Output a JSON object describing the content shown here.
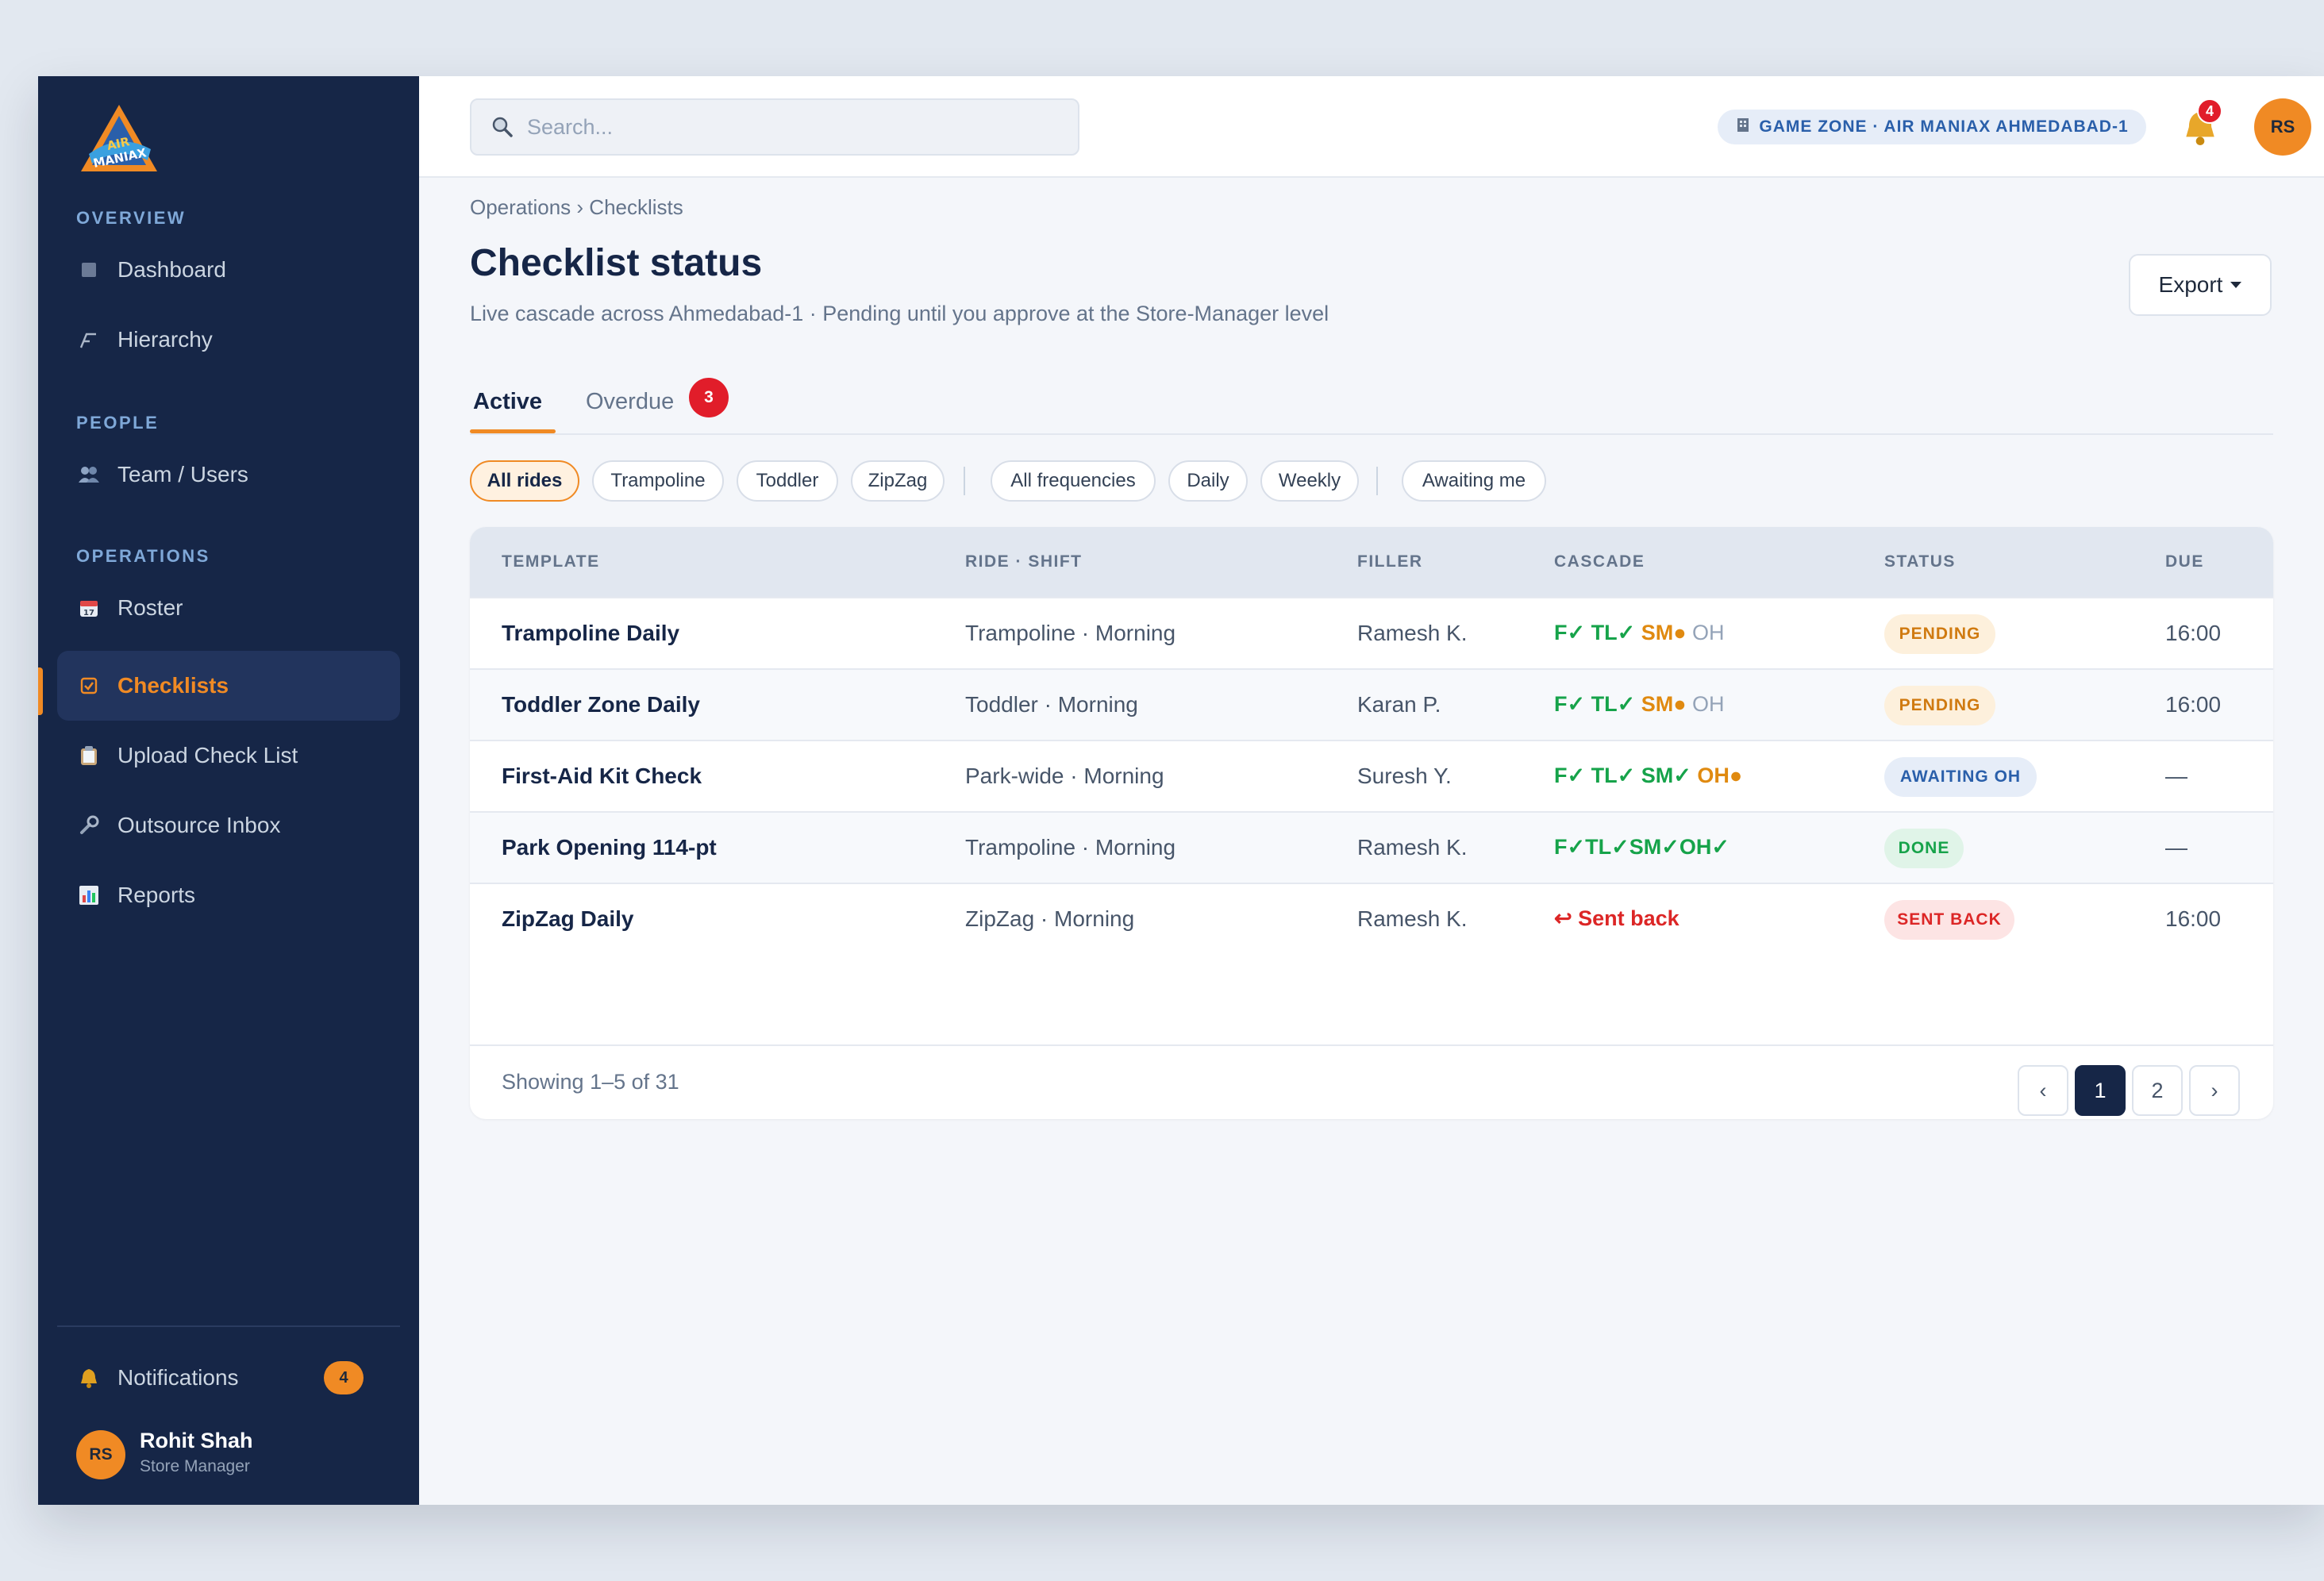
{
  "brand": {
    "logo_text": "AIR MANIAX"
  },
  "sidebar": {
    "sections": {
      "overview": "OVERVIEW",
      "people": "PEOPLE",
      "operations": "OPERATIONS"
    },
    "items": {
      "dashboard": "Dashboard",
      "hierarchy": "Hierarchy",
      "team": "Team / Users",
      "roster": "Roster",
      "checklists": "Checklists",
      "upload": "Upload Check List",
      "outsource": "Outsource Inbox",
      "reports": "Reports"
    },
    "notifications": {
      "label": "Notifications",
      "count": "4"
    },
    "user": {
      "initials": "RS",
      "name": "Rohit Shah",
      "role": "Store Manager"
    }
  },
  "topbar": {
    "search_placeholder": "Search...",
    "zone": "GAME ZONE · AIR MANIAX AHMEDABAD-1",
    "bell_count": "4",
    "avatar": "RS"
  },
  "page": {
    "breadcrumb": "Operations › Checklists",
    "title": "Checklist status",
    "subtitle": "Live cascade across Ahmedabad-1 · Pending until you approve at the Store-Manager level",
    "export": "Export"
  },
  "tabs": {
    "active": "Active",
    "overdue": "Overdue",
    "overdue_count": "3"
  },
  "filters": {
    "rides": [
      "All rides",
      "Trampoline",
      "Toddler",
      "ZipZag"
    ],
    "frequencies": [
      "All frequencies",
      "Daily",
      "Weekly"
    ],
    "awaiting": "Awaiting me",
    "selected": "All rides"
  },
  "table": {
    "headers": {
      "template": "TEMPLATE",
      "ride": "RIDE · SHIFT",
      "filler": "FILLER",
      "cascade": "CASCADE",
      "status": "STATUS",
      "due": "DUE"
    },
    "rows": [
      {
        "template": "Trampoline Daily",
        "ride": "Trampoline · Morning",
        "filler": "Ramesh K.",
        "cascade": {
          "done": "F✓ TL✓ ",
          "pending": "SM●",
          "todo": " OH"
        },
        "status": "PENDING",
        "due": "16:00"
      },
      {
        "template": "Toddler Zone Daily",
        "ride": "Toddler · Morning",
        "filler": "Karan P.",
        "cascade": {
          "done": "F✓ TL✓ ",
          "pending": "SM●",
          "todo": " OH"
        },
        "status": "PENDING",
        "due": "16:00"
      },
      {
        "template": "First-Aid Kit Check",
        "ride": "Park-wide · Morning",
        "filler": "Suresh Y.",
        "cascade": {
          "done": "F✓ TL✓ SM✓ ",
          "pending": "OH●",
          "todo": ""
        },
        "status": "AWAITING OH",
        "due": "—"
      },
      {
        "template": "Park Opening 114-pt",
        "ride": "Trampoline · Morning",
        "filler": "Ramesh K.",
        "cascade": {
          "done": "F✓TL✓SM✓OH✓",
          "pending": "",
          "todo": ""
        },
        "status": "DONE",
        "due": "—"
      },
      {
        "template": "ZipZag Daily",
        "ride": "ZipZag · Morning",
        "filler": "Ramesh K.",
        "cascade": {
          "back": "↩ Sent back"
        },
        "status": "SENT BACK",
        "due": "16:00"
      }
    ],
    "footer": {
      "showing": "Showing 1–5 of 31"
    },
    "pagination": {
      "prev": "‹",
      "pages": [
        "1",
        "2"
      ],
      "next": "›",
      "current": "1"
    }
  },
  "colors": {
    "accent": "#f08a24",
    "sidebar_bg": "#162647",
    "done": "#16a34a",
    "pending": "#e08a10",
    "back": "#dc2626"
  }
}
